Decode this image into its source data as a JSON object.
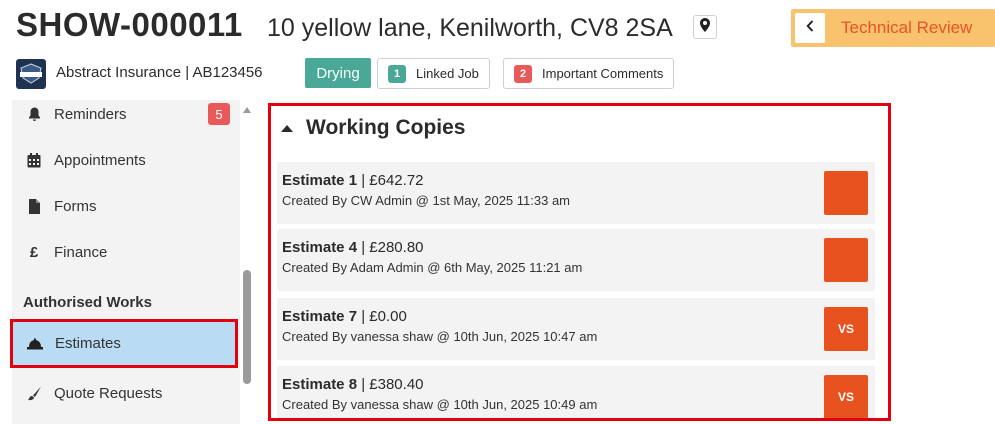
{
  "header": {
    "job_id": "SHOW-000011",
    "address": "10 yellow lane, Kenilworth, CV8 2SA",
    "status_label": "Technical Review",
    "insurer": "Abstract Insurance | AB123456",
    "insurer_logo_text": "INSURANCE",
    "stage_badge": "Drying",
    "linked_job": {
      "count": "1",
      "label": "Linked Job"
    },
    "important_comments": {
      "count": "2",
      "label": "Important Comments"
    }
  },
  "sidebar": {
    "items": [
      {
        "label": "Reminders",
        "icon": "bell-icon",
        "badge": "5"
      },
      {
        "label": "Appointments",
        "icon": "calendar-icon"
      },
      {
        "label": "Forms",
        "icon": "file-icon"
      },
      {
        "label": "Finance",
        "icon": "pound-icon",
        "icon_glyph": "£"
      },
      {
        "label": "Estimates",
        "icon": "hard-hat-icon",
        "active": true
      },
      {
        "label": "Quote Requests",
        "icon": "paint-brush-icon"
      }
    ],
    "section_label": "Authorised Works"
  },
  "panel": {
    "title": "Working Copies",
    "estimates": [
      {
        "name": "Estimate 1",
        "amount": "| £642.72",
        "created": "Created By CW Admin @ 1st May, 2025 11:33 am",
        "button": ""
      },
      {
        "name": "Estimate 4",
        "amount": "| £280.80",
        "created": "Created By Adam Admin @ 6th May, 2025 11:21 am",
        "button": ""
      },
      {
        "name": "Estimate 7",
        "amount": "| £0.00",
        "created": "Created By vanessa shaw @ 10th Jun, 2025 10:47 am",
        "button": "VS"
      },
      {
        "name": "Estimate 8",
        "amount": "| £380.40",
        "created": "Created By vanessa shaw @ 10th Jun, 2025 10:49 am",
        "button": "VS"
      }
    ]
  },
  "colors": {
    "accent_orange": "#e8521f",
    "status_bg": "#f9c26d",
    "teal": "#4aa897",
    "highlight_red": "#e00010",
    "active_blue": "#b9dcf4"
  }
}
